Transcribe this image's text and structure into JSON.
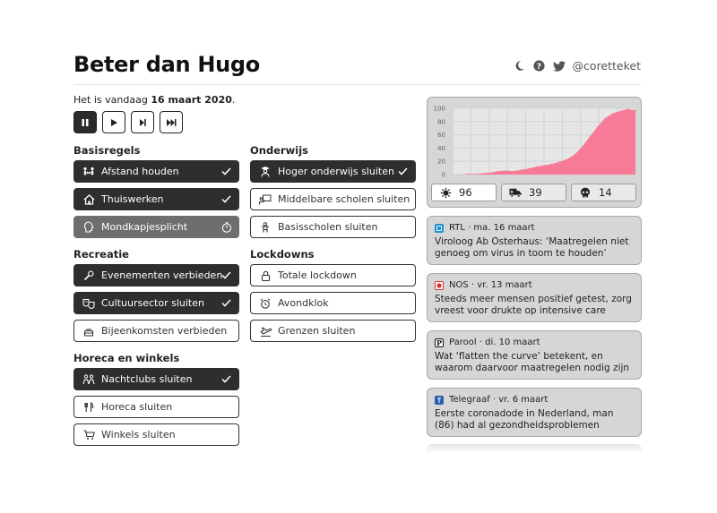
{
  "header": {
    "title": "Beter dan Hugo",
    "handle": "@coretteket"
  },
  "today": {
    "prefix": "Het is vandaag ",
    "date": "16 maart 2020",
    "suffix": "."
  },
  "controls": [
    "pause",
    "play",
    "step-forward",
    "fast-forward"
  ],
  "sections": {
    "basisregels": "Basisregels",
    "recreatie": "Recreatie",
    "horeca": "Horeca en winkels",
    "onderwijs": "Onderwijs",
    "lockdowns": "Lockdowns"
  },
  "measures": {
    "afstand": "Afstand houden",
    "thuiswerken": "Thuiswerken",
    "mondkapje": "Mondkapjesplicht",
    "evenementen": "Evenementen verbieden",
    "cultuur": "Cultuursector sluiten",
    "bijeenkomsten": "Bijeenkomsten verbieden",
    "nachtclubs": "Nachtclubs sluiten",
    "horeca": "Horeca sluiten",
    "winkels": "Winkels sluiten",
    "hoger": "Hoger onderwijs sluiten",
    "middelbare": "Middelbare scholen sluiten",
    "basisscholen": "Basisscholen sluiten",
    "lockdown": "Totale lockdown",
    "avondklok": "Avondklok",
    "grenzen": "Grenzen sluiten"
  },
  "chart_data": {
    "type": "area",
    "yticks": [
      "100",
      "80",
      "60",
      "40",
      "20",
      "0"
    ],
    "ylim": [
      0,
      100
    ],
    "grid": true,
    "color": "#f77a97",
    "values": [
      0,
      0,
      1,
      1,
      2,
      3,
      5,
      6,
      5,
      7,
      9,
      12,
      14,
      16,
      19,
      23,
      30,
      42,
      57,
      72,
      85,
      92,
      96,
      99,
      97
    ]
  },
  "stats": {
    "infected": "96",
    "hospital": "39",
    "deaths": "14"
  },
  "news": [
    {
      "logo": "rtl",
      "logo_color": "#1f8fd6",
      "source": "RTL · ma. 16 maart",
      "headline": "Viroloog Ab Osterhaus: ‘Maatregelen niet genoeg om virus in toom te houden’"
    },
    {
      "logo": "nos",
      "logo_color": "#d83232",
      "source": "NOS · vr. 13 maart",
      "headline": "Steeds meer mensen positief getest, zorg vreest voor drukte op intensive care"
    },
    {
      "logo": "parool",
      "logo_color": "#111111",
      "source": "Parool · di. 10 maart",
      "headline": "Wat ‘flatten the curve’ betekent, en waarom daarvoor maatregelen nodig zijn"
    },
    {
      "logo": "telegraaf",
      "logo_color": "#2a5fb0",
      "source": "Telegraaf · vr. 6 maart",
      "headline": "Eerste coronadode in Nederland, man (86) had al gezondheidsproblemen"
    }
  ]
}
